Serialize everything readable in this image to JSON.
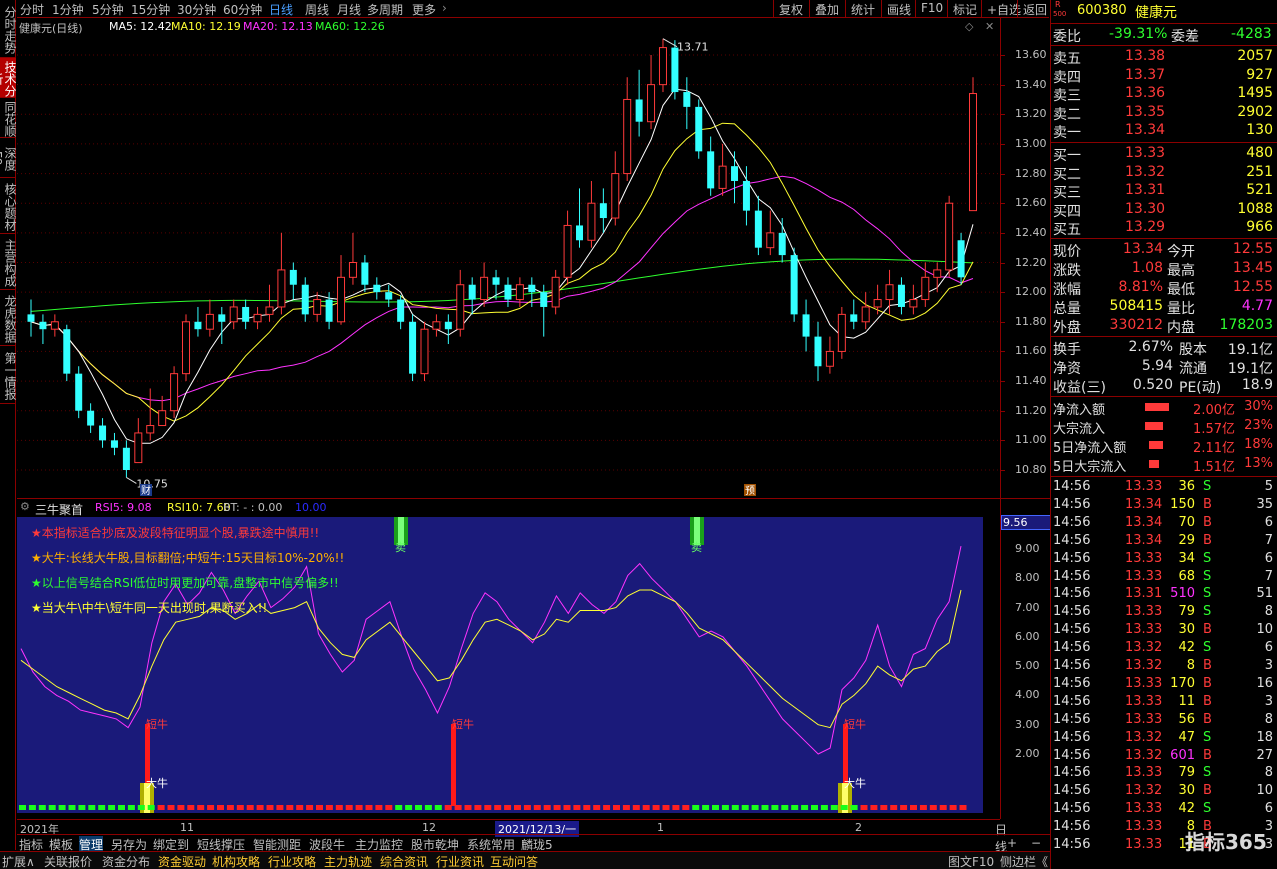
{
  "left_tabs": [
    {
      "label": "分时走势",
      "active": false
    },
    {
      "label": "技术分析",
      "active": true
    },
    {
      "label": "同花顺",
      "active": false
    },
    {
      "label": "深度F9",
      "active": false
    },
    {
      "label": "核心题材",
      "active": false
    },
    {
      "label": "主营构成",
      "active": false
    },
    {
      "label": "龙虎数据",
      "active": false
    },
    {
      "label": "第一情报",
      "active": false
    }
  ],
  "periods": [
    "分时",
    "1分钟",
    "5分钟",
    "15分钟",
    "30分钟",
    "60分钟",
    "日线",
    "周线",
    "月线",
    "多周期",
    "更多"
  ],
  "active_period": "日线",
  "toolbar_right": [
    "复权",
    "叠加",
    "统计",
    "画线",
    "F10",
    "标记",
    "+自选",
    "返回"
  ],
  "ma_legend": {
    "name": "健康元(日线)",
    "ma5": "MA5: 12.42",
    "ma10": "MA10: 12.19",
    "ma20": "MA20: 12.13",
    "ma60": "MA60: 12.26"
  },
  "colors": {
    "up": "#ff3a3a",
    "down": "#33ffff",
    "ma5": "#ffffff",
    "ma10": "#ffff33",
    "ma20": "#ff33ff",
    "ma60": "#2eff2e"
  },
  "price_axis": [
    "13.60",
    "13.40",
    "13.20",
    "13.00",
    "12.80",
    "12.60",
    "12.40",
    "12.20",
    "12.00",
    "11.80",
    "11.60",
    "11.40",
    "11.20",
    "11.00",
    "10.80"
  ],
  "annotations": {
    "high": "13.71",
    "low": "10.75",
    "cai": "财",
    "yu": "预"
  },
  "sub_indicator": {
    "name": "三牛聚首",
    "rsi5": "RSI5: 9.08",
    "rsi10": "RSI10: 7.60",
    "bt": "BT: - : 0.00",
    "extra": "10.00",
    "current": "9.56"
  },
  "sub_axis": [
    "9.00",
    "8.00",
    "7.00",
    "6.00",
    "5.00",
    "4.00",
    "3.00",
    "2.00"
  ],
  "sub_notes": [
    {
      "text": "★本指标适合抄底及波段特征明显个股,暴跌途中慎用!!",
      "color": "#ff3a3a"
    },
    {
      "text": "★大牛:长线大牛股,目标翻倍;中短牛:15天目标10%-20%!!",
      "color": "#ffb000"
    },
    {
      "text": "★以上信号结合RSI低位时用更加可靠,盘整市中信号偏多!!",
      "color": "#2eff2e"
    },
    {
      "text": "★当大牛\\中牛\\短牛同一天出现时,果断买入!!",
      "color": "#ffff33"
    }
  ],
  "signals": {
    "sell": "卖",
    "short": "短牛",
    "big": "大牛"
  },
  "time_axis": [
    {
      "label": "2021年"
    },
    {
      "label": "11"
    },
    {
      "label": "12"
    },
    {
      "label": "2021/12/13/一"
    },
    {
      "label": "1"
    },
    {
      "label": "2"
    },
    {
      "label": "日线"
    }
  ],
  "bottom_tabs1": [
    "指标",
    "模板",
    "管理",
    "另存为",
    "绑定到",
    "短线撑压",
    "智能测距",
    "波段牛",
    "主力监控",
    "股市乾坤",
    "系统常用",
    "麟珑5"
  ],
  "bottom_tabs1_active": "管理",
  "bottom_tabs2": [
    "扩展∧",
    "关联报价",
    "资金分布",
    "资金驱动",
    "机构攻略",
    "行业攻略",
    "主力轨迹",
    "综合资讯",
    "行业资讯",
    "互动问答"
  ],
  "bottom_right": [
    "图文F10",
    "侧边栏《"
  ],
  "stock": {
    "code": "600380",
    "name": "健康元",
    "r_label": "R",
    "r_num": "500"
  },
  "weibi": {
    "label": "委比",
    "value": "-39.31%",
    "label2": "委差",
    "value2": "-4283"
  },
  "asks": [
    {
      "label": "卖五",
      "price": "13.38",
      "vol": "2057"
    },
    {
      "label": "卖四",
      "price": "13.37",
      "vol": "927"
    },
    {
      "label": "卖三",
      "price": "13.36",
      "vol": "1495"
    },
    {
      "label": "卖二",
      "price": "13.35",
      "vol": "2902"
    },
    {
      "label": "卖一",
      "price": "13.34",
      "vol": "130"
    }
  ],
  "bids": [
    {
      "label": "买一",
      "price": "13.33",
      "vol": "480"
    },
    {
      "label": "买二",
      "price": "13.32",
      "vol": "251"
    },
    {
      "label": "买三",
      "price": "13.31",
      "vol": "521"
    },
    {
      "label": "买四",
      "price": "13.30",
      "vol": "1088"
    },
    {
      "label": "买五",
      "price": "13.29",
      "vol": "966"
    }
  ],
  "quote": [
    {
      "l1": "现价",
      "v1": "13.34",
      "c1": "red",
      "l2": "今开",
      "v2": "12.55",
      "c2": "red"
    },
    {
      "l1": "涨跌",
      "v1": "1.08",
      "c1": "red",
      "l2": "最高",
      "v2": "13.45",
      "c2": "red"
    },
    {
      "l1": "涨幅",
      "v1": "8.81%",
      "c1": "red",
      "l2": "最低",
      "v2": "12.55",
      "c2": "red"
    },
    {
      "l1": "总量",
      "v1": "508415",
      "c1": "yellow",
      "l2": "量比",
      "v2": "4.77",
      "c2": "magenta"
    },
    {
      "l1": "外盘",
      "v1": "330212",
      "c1": "red",
      "l2": "内盘",
      "v2": "178203",
      "c2": "green"
    }
  ],
  "fundamentals": [
    {
      "l1": "换手",
      "v1": "2.67%",
      "l2": "股本",
      "v2": "19.1亿"
    },
    {
      "l1": "净资",
      "v1": "5.94",
      "l2": "流通",
      "v2": "19.1亿"
    },
    {
      "l1": "收益(三)",
      "v1": "0.520",
      "l2": "PE(动)",
      "v2": "18.9"
    }
  ],
  "flows": [
    {
      "label": "净流入额",
      "value": "2.00亿",
      "pct": "30%",
      "bar": 0.3
    },
    {
      "label": "大宗流入",
      "value": "1.57亿",
      "pct": "23%",
      "bar": 0.23
    },
    {
      "label": "5日净流入额",
      "value": "2.11亿",
      "pct": "18%",
      "bar": 0.18
    },
    {
      "label": "5日大宗流入",
      "value": "1.51亿",
      "pct": "13%",
      "bar": 0.13
    }
  ],
  "ticks": [
    {
      "t": "14:56",
      "p": "13.33",
      "v": "36",
      "s": "S",
      "n": "5"
    },
    {
      "t": "14:56",
      "p": "13.34",
      "v": "150",
      "s": "B",
      "n": "35"
    },
    {
      "t": "14:56",
      "p": "13.34",
      "v": "70",
      "s": "B",
      "n": "6"
    },
    {
      "t": "14:56",
      "p": "13.34",
      "v": "29",
      "s": "B",
      "n": "7"
    },
    {
      "t": "14:56",
      "p": "13.33",
      "v": "34",
      "s": "S",
      "n": "6"
    },
    {
      "t": "14:56",
      "p": "13.33",
      "v": "68",
      "s": "S",
      "n": "7"
    },
    {
      "t": "14:56",
      "p": "13.31",
      "v": "510",
      "s": "S",
      "n": "51"
    },
    {
      "t": "14:56",
      "p": "13.33",
      "v": "79",
      "s": "S",
      "n": "8"
    },
    {
      "t": "14:56",
      "p": "13.33",
      "v": "30",
      "s": "B",
      "n": "10"
    },
    {
      "t": "14:56",
      "p": "13.32",
      "v": "42",
      "s": "S",
      "n": "6"
    },
    {
      "t": "14:56",
      "p": "13.32",
      "v": "8",
      "s": "B",
      "n": "3"
    },
    {
      "t": "14:56",
      "p": "13.33",
      "v": "170",
      "s": "B",
      "n": "16"
    },
    {
      "t": "14:56",
      "p": "13.33",
      "v": "11",
      "s": "B",
      "n": "3"
    },
    {
      "t": "14:56",
      "p": "13.33",
      "v": "56",
      "s": "B",
      "n": "8"
    },
    {
      "t": "14:56",
      "p": "13.32",
      "v": "47",
      "s": "S",
      "n": "18"
    },
    {
      "t": "14:56",
      "p": "13.32",
      "v": "601",
      "s": "B",
      "n": "27"
    },
    {
      "t": "14:56",
      "p": "13.33",
      "v": "79",
      "s": "S",
      "n": "8"
    },
    {
      "t": "14:56",
      "p": "13.32",
      "v": "30",
      "s": "B",
      "n": "10"
    },
    {
      "t": "14:56",
      "p": "13.33",
      "v": "42",
      "s": "S",
      "n": "6"
    },
    {
      "t": "14:56",
      "p": "13.33",
      "v": "8",
      "s": "B",
      "n": "3"
    },
    {
      "t": "14:56",
      "p": "13.33",
      "v": "11",
      "s": "B",
      "n": "3"
    }
  ],
  "watermark": "指标365",
  "candles": [
    [
      11.85,
      11.8,
      11.95,
      11.7
    ],
    [
      11.8,
      11.75,
      11.85,
      11.65
    ],
    [
      11.75,
      11.8,
      11.85,
      11.7
    ],
    [
      11.75,
      11.45,
      11.78,
      11.4
    ],
    [
      11.45,
      11.2,
      11.5,
      11.15
    ],
    [
      11.2,
      11.1,
      11.25,
      11.05
    ],
    [
      11.1,
      11.0,
      11.15,
      10.95
    ],
    [
      11.0,
      10.95,
      11.05,
      10.9
    ],
    [
      10.95,
      10.8,
      11.0,
      10.75
    ],
    [
      10.85,
      11.05,
      11.15,
      10.85
    ],
    [
      11.05,
      11.1,
      11.35,
      11.0
    ],
    [
      11.1,
      11.2,
      11.3,
      11.1
    ],
    [
      11.2,
      11.45,
      11.5,
      11.15
    ],
    [
      11.45,
      11.8,
      11.85,
      11.4
    ],
    [
      11.8,
      11.75,
      11.9,
      11.7
    ],
    [
      11.75,
      11.85,
      11.95,
      11.7
    ],
    [
      11.85,
      11.8,
      11.9,
      11.65
    ],
    [
      11.8,
      11.9,
      11.95,
      11.75
    ],
    [
      11.9,
      11.8,
      11.95,
      11.75
    ],
    [
      11.8,
      11.85,
      11.9,
      11.75
    ],
    [
      11.85,
      11.9,
      12.05,
      11.8
    ],
    [
      11.9,
      12.15,
      12.4,
      11.85
    ],
    [
      12.15,
      12.05,
      12.2,
      11.95
    ],
    [
      12.05,
      11.85,
      12.1,
      11.8
    ],
    [
      11.85,
      11.95,
      12.0,
      11.8
    ],
    [
      11.95,
      11.8,
      12.0,
      11.75
    ],
    [
      11.8,
      12.1,
      12.25,
      11.78
    ],
    [
      12.1,
      12.2,
      12.4,
      12.05
    ],
    [
      12.2,
      12.05,
      12.25,
      12.0
    ],
    [
      12.05,
      12.0,
      12.1,
      11.95
    ],
    [
      12.0,
      11.95,
      12.05,
      11.9
    ],
    [
      11.95,
      11.8,
      11.98,
      11.75
    ],
    [
      11.8,
      11.45,
      11.85,
      11.4
    ],
    [
      11.45,
      11.75,
      11.8,
      11.4
    ],
    [
      11.75,
      11.8,
      11.85,
      11.7
    ],
    [
      11.8,
      11.75,
      11.85,
      11.65
    ],
    [
      11.75,
      12.05,
      12.15,
      11.7
    ],
    [
      12.05,
      11.95,
      12.1,
      11.85
    ],
    [
      11.95,
      12.1,
      12.2,
      11.9
    ],
    [
      12.1,
      12.05,
      12.15,
      11.95
    ],
    [
      12.05,
      11.95,
      12.1,
      11.9
    ],
    [
      11.95,
      12.05,
      12.1,
      11.9
    ],
    [
      12.05,
      12.0,
      12.1,
      11.9
    ],
    [
      12.0,
      11.9,
      12.05,
      11.7
    ],
    [
      11.9,
      12.1,
      12.15,
      11.85
    ],
    [
      12.1,
      12.45,
      12.55,
      12.05
    ],
    [
      12.45,
      12.35,
      12.7,
      12.3
    ],
    [
      12.35,
      12.6,
      12.75,
      12.3
    ],
    [
      12.6,
      12.5,
      12.7,
      12.4
    ],
    [
      12.5,
      12.8,
      12.95,
      12.45
    ],
    [
      12.8,
      13.3,
      13.45,
      12.75
    ],
    [
      13.3,
      13.15,
      13.5,
      13.05
    ],
    [
      13.15,
      13.4,
      13.6,
      13.1
    ],
    [
      13.4,
      13.65,
      13.71,
      13.35
    ],
    [
      13.65,
      13.35,
      13.7,
      13.3
    ],
    [
      13.35,
      13.25,
      13.45,
      13.1
    ],
    [
      13.25,
      12.95,
      13.3,
      12.9
    ],
    [
      12.95,
      12.7,
      13.05,
      12.65
    ],
    [
      12.7,
      12.85,
      13.0,
      12.65
    ],
    [
      12.85,
      12.75,
      12.95,
      12.6
    ],
    [
      12.75,
      12.55,
      12.85,
      12.45
    ],
    [
      12.55,
      12.3,
      12.65,
      12.25
    ],
    [
      12.3,
      12.4,
      12.55,
      12.25
    ],
    [
      12.4,
      12.25,
      12.5,
      12.2
    ],
    [
      12.25,
      11.85,
      12.3,
      11.8
    ],
    [
      11.85,
      11.7,
      11.95,
      11.6
    ],
    [
      11.7,
      11.5,
      11.8,
      11.4
    ],
    [
      11.5,
      11.6,
      11.7,
      11.45
    ],
    [
      11.6,
      11.85,
      11.9,
      11.55
    ],
    [
      11.85,
      11.8,
      11.95,
      11.75
    ],
    [
      11.8,
      11.9,
      12.0,
      11.75
    ],
    [
      11.9,
      11.95,
      12.05,
      11.85
    ],
    [
      11.95,
      12.05,
      12.15,
      11.85
    ],
    [
      12.05,
      11.9,
      12.1,
      11.85
    ],
    [
      11.9,
      11.95,
      12.05,
      11.85
    ],
    [
      11.95,
      12.1,
      12.2,
      11.9
    ],
    [
      12.1,
      12.15,
      12.2,
      12.0
    ],
    [
      12.15,
      12.6,
      12.65,
      12.1
    ],
    [
      12.35,
      12.1,
      12.4,
      12.05
    ],
    [
      12.55,
      13.34,
      13.45,
      12.55
    ]
  ],
  "rsi_pink": [
    5.6,
    4.8,
    4.3,
    4.0,
    3.8,
    3.5,
    3.4,
    3.3,
    3.2,
    2.9,
    3.6,
    5.8,
    7.2,
    7.8,
    7.1,
    7.5,
    8.2,
    7.6,
    6.8,
    7.4,
    7.9,
    7.0,
    7.3,
    7.7,
    8.4,
    6.1,
    5.4,
    4.8,
    5.2,
    6.6,
    6.9,
    7.2,
    6.0,
    4.9,
    4.2,
    3.4,
    4.3,
    5.6,
    6.8,
    7.5,
    7.2,
    6.6,
    6.2,
    5.8,
    6.5,
    7.4,
    6.8,
    7.5,
    7.1,
    6.8,
    7.2,
    8.1,
    8.5,
    8.0,
    7.6,
    7.2,
    6.6,
    6.0,
    6.2,
    6.0,
    5.5,
    5.0,
    4.4,
    3.8,
    3.2,
    2.8,
    2.4,
    2.0,
    2.2,
    4.2,
    4.6,
    5.2,
    6.4,
    5.0,
    4.3,
    5.4,
    5.6,
    6.6,
    7.2,
    9.1
  ],
  "rsi_yellow": [
    5.2,
    4.9,
    4.6,
    4.3,
    4.1,
    3.9,
    3.7,
    3.5,
    3.4,
    3.2,
    4.0,
    5.0,
    5.9,
    6.5,
    6.6,
    6.7,
    7.0,
    6.9,
    6.6,
    6.8,
    7.1,
    6.8,
    6.9,
    7.0,
    7.2,
    6.3,
    5.8,
    5.4,
    5.3,
    5.9,
    6.2,
    6.5,
    6.0,
    5.5,
    5.0,
    4.5,
    4.6,
    5.2,
    5.9,
    6.5,
    6.6,
    6.4,
    6.2,
    5.9,
    6.1,
    6.6,
    6.5,
    6.9,
    6.9,
    6.9,
    7.0,
    7.4,
    7.6,
    7.6,
    7.4,
    7.2,
    6.8,
    6.3,
    6.1,
    5.9,
    5.5,
    5.1,
    4.7,
    4.3,
    3.9,
    3.6,
    3.3,
    3.0,
    2.9,
    3.7,
    4.0,
    4.4,
    5.0,
    4.7,
    4.5,
    4.9,
    5.0,
    5.5,
    5.8,
    7.6
  ]
}
